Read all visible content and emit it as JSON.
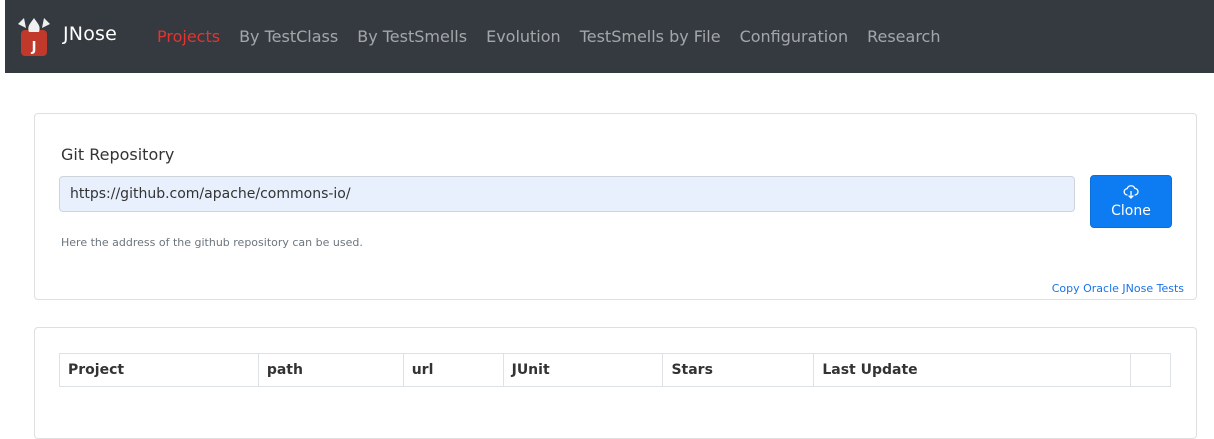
{
  "navbar": {
    "brand": "JNose",
    "logo_icon": "jnose-logo",
    "links": [
      {
        "label": "Projects",
        "active": true
      },
      {
        "label": "By TestClass",
        "active": false
      },
      {
        "label": "By TestSmells",
        "active": false
      },
      {
        "label": "Evolution",
        "active": false
      },
      {
        "label": "TestSmells by File",
        "active": false
      },
      {
        "label": "Configuration",
        "active": false
      },
      {
        "label": "Research",
        "active": false
      }
    ]
  },
  "repo_form": {
    "label": "Git Repository",
    "input_value": "https://github.com/apache/commons-io/",
    "help_text": "Here the address of the github repository can be used.",
    "clone_label": "Clone",
    "clone_icon": "cloud-download-icon",
    "copy_link": "Copy Oracle JNose Tests"
  },
  "projects_table": {
    "columns": [
      "Project",
      "path",
      "url",
      "JUnit",
      "Stars",
      "Last Update",
      ""
    ]
  },
  "colors": {
    "navbar_bg": "#343a40",
    "active_link": "#e3342f",
    "primary": "#0d7cf2",
    "input_bg": "#e8f0fe"
  }
}
